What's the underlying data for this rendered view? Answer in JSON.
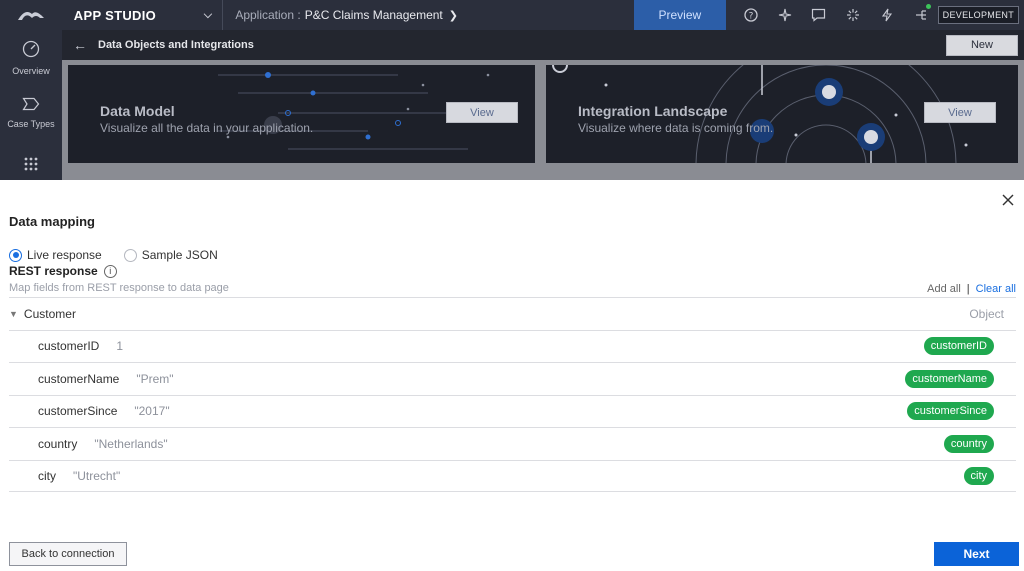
{
  "topbar": {
    "app_studio": "APP STUDIO",
    "application_label": "Application :",
    "application_name": "P&C Claims Management",
    "preview": "Preview",
    "environment": "DEVELOPMENT"
  },
  "sidebar": {
    "items": [
      {
        "label": "Overview",
        "icon": "gauge-icon"
      },
      {
        "label": "Case Types",
        "icon": "chevron-tag-icon"
      },
      {
        "label": "",
        "icon": "grid-icon"
      }
    ]
  },
  "subheader": {
    "title": "Data Objects and Integrations",
    "new_label": "New"
  },
  "cards": [
    {
      "title": "Data Model",
      "description": "Visualize all the data in your application.",
      "view": "View"
    },
    {
      "title": "Integration Landscape",
      "description": "Visualize where data is coming from.",
      "view": "View"
    }
  ],
  "modal": {
    "title": "Data mapping",
    "radio_live": "Live response",
    "radio_sample": "Sample JSON",
    "rest_title": "REST response",
    "rest_desc": "Map fields from REST response to data page",
    "add_all": "Add all",
    "clear_all": "Clear all",
    "group": {
      "name": "Customer",
      "type": "Object"
    },
    "fields": [
      {
        "name": "customerID",
        "value": "1",
        "mapped": "customerID"
      },
      {
        "name": "customerName",
        "value": "\"Prem\"",
        "mapped": "customerName"
      },
      {
        "name": "customerSince",
        "value": "\"2017\"",
        "mapped": "customerSince"
      },
      {
        "name": "country",
        "value": "\"Netherlands\"",
        "mapped": "country"
      },
      {
        "name": "city",
        "value": "\"Utrecht\"",
        "mapped": "city"
      }
    ],
    "back_label": "Back to connection",
    "next_label": "Next"
  },
  "colors": {
    "topbar": "#2b2f3c",
    "accent": "#0b63d8",
    "pill": "#1fa84f"
  }
}
